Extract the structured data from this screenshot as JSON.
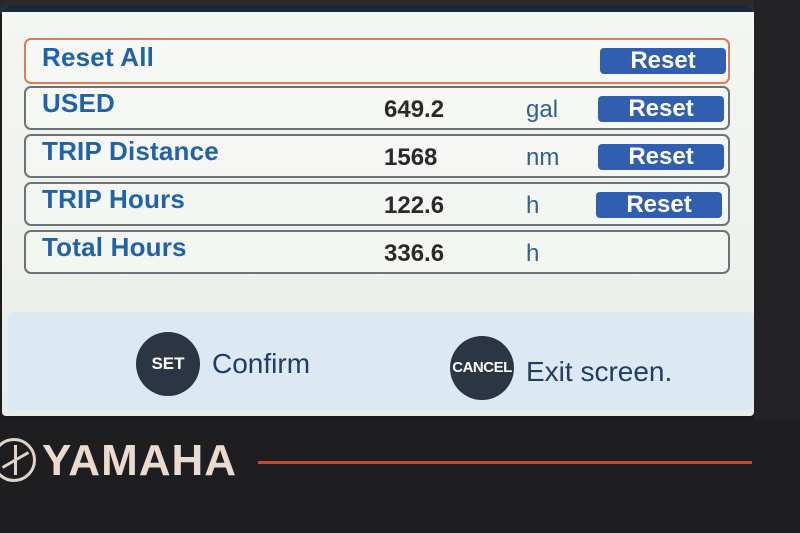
{
  "rows": [
    {
      "label": "Reset All",
      "value": "",
      "unit": "",
      "button": "Reset"
    },
    {
      "label": "USED",
      "value": "649.2",
      "unit": "gal",
      "button": "Reset"
    },
    {
      "label": "TRIP Distance",
      "value": "1568",
      "unit": "nm",
      "button": "Reset"
    },
    {
      "label": "TRIP Hours",
      "value": "122.6",
      "unit": "h",
      "button": "Reset"
    },
    {
      "label": "Total Hours",
      "value": "336.6",
      "unit": "h",
      "button": ""
    }
  ],
  "footer": {
    "set_key": "SET",
    "set_label": "Confirm",
    "cancel_key": "CANCEL",
    "cancel_label": "Exit screen."
  },
  "brand": {
    "name": "YAMAHA",
    "logo_icon": "tuning-fork-logo-icon"
  },
  "colors": {
    "label_blue": "#1f63ae",
    "button_blue": "#2f5fae",
    "selection_orange": "#e07a56",
    "accent_red": "#c24a2b"
  }
}
